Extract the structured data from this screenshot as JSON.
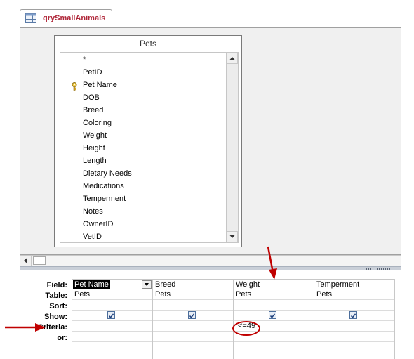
{
  "tab": {
    "label": "qrySmallAnimals",
    "icon": "query-icon"
  },
  "table_box": {
    "title": "Pets",
    "fields": [
      "*",
      "PetID",
      "Pet Name",
      "DOB",
      "Breed",
      "Coloring",
      "Weight",
      "Height",
      "Length",
      "Dietary Needs",
      "Medications",
      "Temperment",
      "Notes",
      "OwnerID",
      "VetID"
    ],
    "primary_key_field": "PetID"
  },
  "grid": {
    "row_labels": {
      "field": "Field:",
      "table": "Table:",
      "sort": "Sort:",
      "show": "Show:",
      "criteria": "Criteria:",
      "or": "or:"
    },
    "columns": [
      {
        "field": "Pet Name",
        "table": "Pets",
        "sort": "",
        "show": true,
        "criteria": "",
        "or": "",
        "selected": true
      },
      {
        "field": "Breed",
        "table": "Pets",
        "sort": "",
        "show": true,
        "criteria": "",
        "or": ""
      },
      {
        "field": "Weight",
        "table": "Pets",
        "sort": "",
        "show": true,
        "criteria": "<=49",
        "or": ""
      },
      {
        "field": "Temperment",
        "table": "Pets",
        "sort": "",
        "show": true,
        "criteria": "",
        "or": ""
      }
    ]
  },
  "annotation_color": "#c00000"
}
